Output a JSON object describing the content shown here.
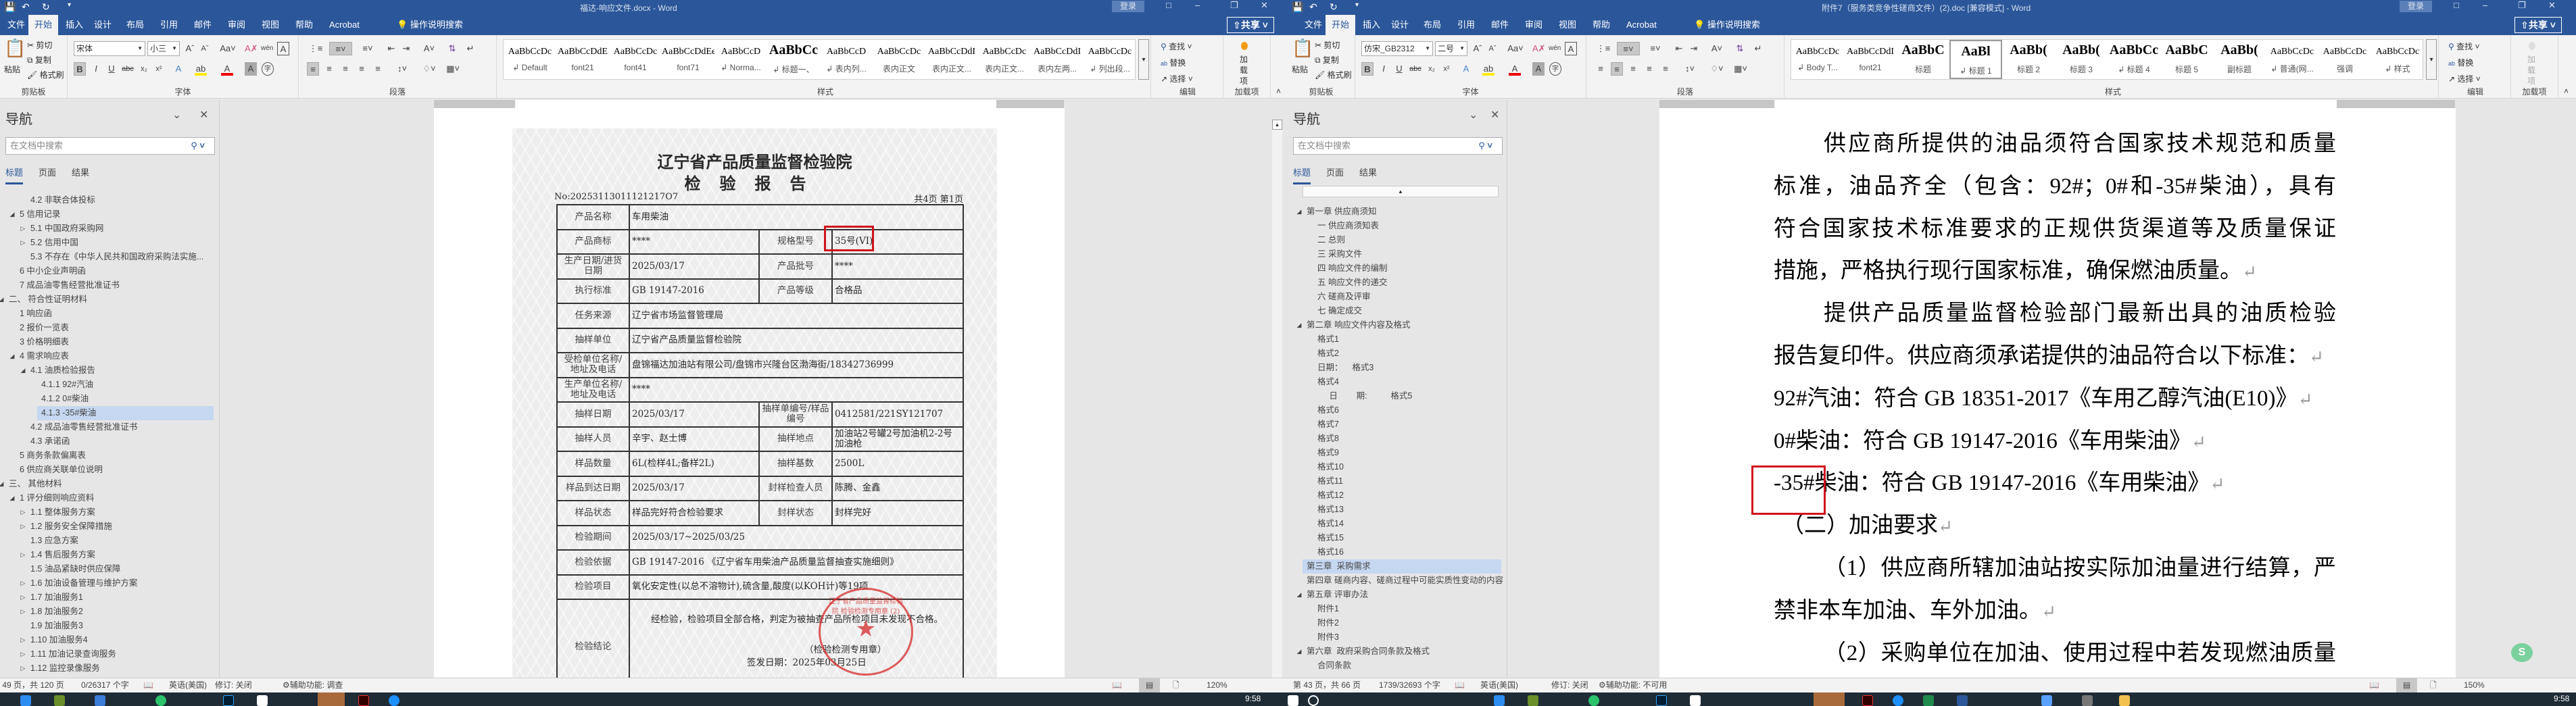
{
  "windows": [
    {
      "title": "福达-响应文件.docx  -  Word",
      "tabs": [
        "文件",
        "开始",
        "插入",
        "设计",
        "布局",
        "引用",
        "邮件",
        "审阅",
        "视图",
        "帮助",
        "Acrobat"
      ],
      "active_tab": 1,
      "tell_me": "操作说明搜索",
      "login": "登录",
      "share": "共享",
      "clipboard": {
        "paste": "粘贴",
        "cut": "剪切",
        "copy": "复制",
        "format_painter": "格式刷",
        "label": "剪贴板"
      },
      "font": {
        "name": "宋体",
        "size": "小三",
        "label": "字体"
      },
      "paragraph_label": "段落",
      "styles_label": "样式",
      "styles": [
        {
          "preview": "AaBbCcDc",
          "name": "↲ Default"
        },
        {
          "preview": "AaBbCcDdE",
          "name": "font21"
        },
        {
          "preview": "AaBbCcDc",
          "name": "font41"
        },
        {
          "preview": "AaBbCcDdEe",
          "name": "font71"
        },
        {
          "preview": "AaBbCcD",
          "name": "↲ Norma..."
        },
        {
          "preview": "AaBbCc",
          "name": "↲ 标题一、"
        },
        {
          "preview": "AaBbCcD",
          "name": "↲ 表内列..."
        },
        {
          "preview": "AaBbCcDc",
          "name": "表内正文"
        },
        {
          "preview": "AaBbCcDdI",
          "name": "表内正文..."
        },
        {
          "preview": "AaBbCcDc",
          "name": "表内正文..."
        },
        {
          "preview": "AaBbCcDdI",
          "name": "表内左两..."
        },
        {
          "preview": "AaBbCcDc",
          "name": "↲ 列出段..."
        }
      ],
      "selected_style": -1,
      "editing": {
        "find": "查找",
        "replace": "替换",
        "select": "选择",
        "label": "编辑"
      },
      "addins": {
        "button": "加载项",
        "label": "加载项"
      },
      "nav": {
        "title": "导航",
        "search_placeholder": "在文档中搜索",
        "tabs": [
          "标题",
          "页面",
          "结果"
        ],
        "items": [
          {
            "text": "4.2 非联合体投标",
            "level": 2,
            "state": ""
          },
          {
            "text": "5 信用记录",
            "level": 1,
            "state": "open"
          },
          {
            "text": "5.1 中国政府采购网",
            "level": 2,
            "state": "closed"
          },
          {
            "text": "5.2 信用中国",
            "level": 2,
            "state": "closed"
          },
          {
            "text": "5.3 不存在《中华人民共和国政府采购法实施...",
            "level": 2,
            "state": ""
          },
          {
            "text": "6 中小企业声明函",
            "level": 1,
            "state": ""
          },
          {
            "text": "7 成品油零售经营批准证书",
            "level": 1,
            "state": ""
          },
          {
            "text": "二、 符合性证明材料",
            "level": 0,
            "state": "open"
          },
          {
            "text": "1 响应函",
            "level": 1,
            "state": ""
          },
          {
            "text": "2 报价一览表",
            "level": 1,
            "state": ""
          },
          {
            "text": "3 价格明细表",
            "level": 1,
            "state": ""
          },
          {
            "text": "4 需求响应表",
            "level": 1,
            "state": "open"
          },
          {
            "text": "4.1 油质检验报告",
            "level": 2,
            "state": "open"
          },
          {
            "text": "4.1.1 92#汽油",
            "level": 3,
            "state": ""
          },
          {
            "text": "4.1.2 0#柴油",
            "level": 3,
            "state": ""
          },
          {
            "text": "4.1.3 -35#柴油",
            "level": 3,
            "state": "",
            "selected": true
          },
          {
            "text": "4.2 成品油零售经营批准证书",
            "level": 2,
            "state": ""
          },
          {
            "text": "4.3 承诺函",
            "level": 2,
            "state": ""
          },
          {
            "text": "5 商务条款偏离表",
            "level": 1,
            "state": ""
          },
          {
            "text": "6 供应商关联单位说明",
            "level": 1,
            "state": ""
          },
          {
            "text": "三、 其他材料",
            "level": 0,
            "state": "open"
          },
          {
            "text": "1 评分细则响应资料",
            "level": 1,
            "state": "open"
          },
          {
            "text": "1.1 整体服务方案",
            "level": 2,
            "state": "closed"
          },
          {
            "text": "1.2 服务安全保障措施",
            "level": 2,
            "state": "closed"
          },
          {
            "text": "1.3 应急方案",
            "level": 2,
            "state": ""
          },
          {
            "text": "1.4 售后服务方案",
            "level": 2,
            "state": "closed"
          },
          {
            "text": "1.5 油品紧缺时供应保障",
            "level": 2,
            "state": ""
          },
          {
            "text": "1.6 加油设备管理与维护方案",
            "level": 2,
            "state": "closed"
          },
          {
            "text": "1.7 加油服务1",
            "level": 2,
            "state": "closed"
          },
          {
            "text": "1.8 加油服务2",
            "level": 2,
            "state": "closed"
          },
          {
            "text": "1.9 加油服务3",
            "level": 2,
            "state": ""
          },
          {
            "text": "1.10 加油服务4",
            "level": 2,
            "state": "closed"
          },
          {
            "text": "1.11 加油记录查询服务",
            "level": 2,
            "state": "closed"
          },
          {
            "text": "1.12 监控录像服务",
            "level": 2,
            "state": "closed"
          }
        ]
      },
      "status": {
        "page": "第 49 页，共 120 页",
        "words": "0/26317 个字",
        "language": "英语(美国)",
        "track": "修订: 关闭",
        "accessibility": "辅助功能: 调查",
        "zoom": "120%"
      }
    },
    {
      "title": "附件7（服务类竞争性磋商文件）(2).doc [兼容模式]  -  Word",
      "tabs": [
        "文件",
        "开始",
        "插入",
        "设计",
        "布局",
        "引用",
        "邮件",
        "审阅",
        "视图",
        "帮助",
        "Acrobat"
      ],
      "active_tab": 1,
      "tell_me": "操作说明搜索",
      "login": "登录",
      "share": "共享",
      "clipboard": {
        "paste": "粘贴",
        "cut": "剪切",
        "copy": "复制",
        "format_painter": "格式刷",
        "label": "剪贴板"
      },
      "font": {
        "name": "仿宋_GB2312",
        "size": "二号",
        "label": "字体"
      },
      "paragraph_label": "段落",
      "styles_label": "样式",
      "styles": [
        {
          "preview": "AaBbCcDc",
          "name": "↲ Body T..."
        },
        {
          "preview": "AaBbCcDdI",
          "name": "font21"
        },
        {
          "preview": "AaBbC",
          "name": "标题"
        },
        {
          "preview": "AaBl",
          "name": "↲ 标题 1"
        },
        {
          "preview": "AaBb(",
          "name": "标题 2"
        },
        {
          "preview": "AaBb(",
          "name": "标题 3"
        },
        {
          "preview": "AaBbCc",
          "name": "↲ 标题 4"
        },
        {
          "preview": "AaBbC",
          "name": "标题 5"
        },
        {
          "preview": "AaBb(",
          "name": "副标题"
        },
        {
          "preview": "AaBbCcDc",
          "name": "↲ 普通(网..."
        },
        {
          "preview": "AaBbCcDc",
          "name": "强调"
        },
        {
          "preview": "AaBbCcDc",
          "name": "↲ 样式"
        }
      ],
      "selected_style": 3,
      "editing": {
        "find": "查找",
        "replace": "替换",
        "select": "选择",
        "label": "编辑"
      },
      "addins": {
        "button": "加载项",
        "label": "加载项"
      },
      "nav": {
        "title": "导航",
        "search_placeholder": "在文档中搜索",
        "tabs": [
          "标题",
          "页面",
          "结果"
        ],
        "items": [
          {
            "text": "第一章 供应商须知",
            "level": 0,
            "state": "open"
          },
          {
            "text": "一 供应商须知表",
            "level": 1,
            "state": ""
          },
          {
            "text": "二 总则",
            "level": 1,
            "state": ""
          },
          {
            "text": "三 采购文件",
            "level": 1,
            "state": ""
          },
          {
            "text": "四 响应文件的编制",
            "level": 1,
            "state": ""
          },
          {
            "text": "五 响应文件的递交",
            "level": 1,
            "state": ""
          },
          {
            "text": "六 磋商及评审",
            "level": 1,
            "state": ""
          },
          {
            "text": "七 确定成交",
            "level": 1,
            "state": ""
          },
          {
            "text": "第二章 响应文件内容及格式",
            "level": 0,
            "state": "open"
          },
          {
            "text": "格式1",
            "level": 1,
            "state": ""
          },
          {
            "text": "格式2",
            "level": 1,
            "state": ""
          },
          {
            "text": "日期：    格式3",
            "level": 1,
            "state": ""
          },
          {
            "text": "格式4",
            "level": 1,
            "state": ""
          },
          {
            "text": "     日        期:          格式5",
            "level": 1,
            "state": ""
          },
          {
            "text": "格式6",
            "level": 1,
            "state": ""
          },
          {
            "text": "格式7",
            "level": 1,
            "state": ""
          },
          {
            "text": "格式8",
            "level": 1,
            "state": ""
          },
          {
            "text": "格式9",
            "level": 1,
            "state": ""
          },
          {
            "text": "格式10",
            "level": 1,
            "state": ""
          },
          {
            "text": "格式11",
            "level": 1,
            "state": ""
          },
          {
            "text": "格式12",
            "level": 1,
            "state": ""
          },
          {
            "text": "格式13",
            "level": 1,
            "state": ""
          },
          {
            "text": "格式14",
            "level": 1,
            "state": ""
          },
          {
            "text": "格式15",
            "level": 1,
            "state": ""
          },
          {
            "text": "格式16",
            "level": 1,
            "state": ""
          },
          {
            "text": "第三章  采购需求",
            "level": 0,
            "state": "",
            "selected": true
          },
          {
            "text": "第四章 磋商内容、磋商过程中可能实质性变动的内容",
            "level": 0,
            "state": ""
          },
          {
            "text": "第五章 评审办法",
            "level": 0,
            "state": "open"
          },
          {
            "text": "附件1",
            "level": 1,
            "state": ""
          },
          {
            "text": "附件2",
            "level": 1,
            "state": ""
          },
          {
            "text": "附件3",
            "level": 1,
            "state": ""
          },
          {
            "text": "第六章  政府采购合同条款及格式",
            "level": 0,
            "state": "open"
          },
          {
            "text": "合同条款",
            "level": 1,
            "state": ""
          }
        ]
      },
      "status": {
        "page": "第 43 页，共 66 页",
        "words": "1739/32693 个字",
        "language": "英语(美国)",
        "track": "修订: 关闭",
        "accessibility": "辅助功能: 不可用",
        "zoom": "150%"
      }
    }
  ],
  "scan": {
    "institute": "辽宁省产品质量监督检验院",
    "report_title": "检验报告",
    "number": "No:20253113011121217O7",
    "pages": "共4页  第1页",
    "rows": [
      [
        "产品名称",
        "车用柴油"
      ],
      [
        "产品商标",
        "****",
        "规格型号",
        "35号(VI)"
      ],
      [
        "生产日期/进货日期",
        "2025/03/17",
        "产品批号",
        "****"
      ],
      [
        "执行标准",
        "GB 19147-2016",
        "产品等级",
        "合格品"
      ],
      [
        "任务来源",
        "辽宁省市场监督管理局"
      ],
      [
        "抽样单位",
        "辽宁省产品质量监督检验院"
      ],
      [
        "受检单位名称/地址及电话",
        "盘锦福达加油站有限公司/盘锦市兴隆台区渤海街/18342736999"
      ],
      [
        "生产单位名称/地址及电话",
        "****"
      ],
      [
        "抽样日期",
        "2025/03/17",
        "抽样单编号/样品编号",
        "0412581/221SY121707"
      ],
      [
        "抽样人员",
        "辛宇、赵士博",
        "抽样地点",
        "加油站2号罐2号加油机2-2号加油枪"
      ],
      [
        "样品数量",
        "6L(检样4L;备样2L)",
        "抽样基数",
        "2500L"
      ],
      [
        "样品到达日期",
        "2025/03/17",
        "封样检查人员",
        "陈腾、金鑫"
      ],
      [
        "样品状态",
        "样品完好符合检验要求",
        "封样状态",
        "封样完好"
      ],
      [
        "检验期间",
        "2025/03/17~2025/03/25"
      ],
      [
        "检验依据",
        "GB 19147-2016 《辽宁省车用柴油产品质量监督抽查实施细则》"
      ],
      [
        "检验项目",
        "氧化安定性(以总不溶物计),硫含量,酸度(以KOH计)等19项"
      ]
    ],
    "conclusion_label": "检验结论",
    "conclusion": "经检验，检验项目全部合格，判定为被抽查产品所检项目未发现不合格。",
    "stamp_caption": "（检验检测专用章）",
    "issue_date": "签发日期：2025年03月25日",
    "seal_text": "辽宁省产品质量监督检验院 检验检测专用章 (2)"
  },
  "doc": {
    "lines": [
      {
        "text": "供应商所提供的油品须符合国家技术规范和质量",
        "indent": true,
        "full": true
      },
      {
        "text": "标准，油品齐全（包含：92#；0#和-35#柴油），具有",
        "full": true
      },
      {
        "text": "符合国家技术标准要求的正规供货渠道等及质量保证",
        "full": true
      },
      {
        "text": "措施，严格执行现行国家标准，确保燃油质量。",
        "mark": "↵"
      },
      {
        "text": "提供产品质量监督检验部门最新出具的油质检验",
        "indent": true,
        "full": true
      },
      {
        "text": "报告复印件。供应商须承诺提供的油品符合以下标准：",
        "mark": "↵"
      },
      {
        "text": "92#汽油：符合 GB 18351-2017《车用乙醇汽油(E10)》",
        "mark": "↵"
      },
      {
        "text": "0#柴油：符合 GB 19147-2016《车用柴油》",
        "mark": "↵"
      },
      {
        "text": "-35#柴油：符合 GB 19147-2016《车用柴油》",
        "mark": "↵"
      },
      {
        "text": "（二）加油要求",
        "mark": "↵",
        "small_indent": true
      },
      {
        "text": "（1）供应商所辖加油站按实际加油量进行结算，严",
        "indent": true,
        "full": true
      },
      {
        "text": "禁非本车加油、车外加油。",
        "mark": "↵"
      },
      {
        "text": "（2）采购单位在加油、使用过程中若发现燃油质量",
        "indent": true,
        "full": true
      }
    ]
  },
  "taskbar": {
    "clock": "9:58"
  },
  "colors": {
    "word_blue": "#2b579a",
    "highlight_red": "#d0121b",
    "nav_selected": "#c5d7f1",
    "taskbar": "#1f2b35"
  }
}
